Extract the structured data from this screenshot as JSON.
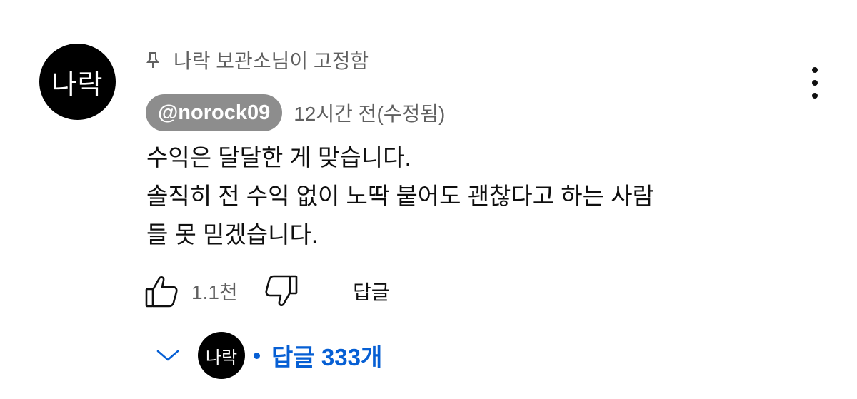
{
  "comment": {
    "avatar_text": "나락",
    "pinned_label": "나락 보관소님이 고정함",
    "author": "@norock09",
    "timestamp": "12시간 전(수정됨)",
    "text_lines": [
      "수익은 달달한 게 맞습니다.",
      "솔직히 전 수익 없이 노딱 붙어도 괜찮다고 하는 사람",
      "들 못 믿겠습니다."
    ],
    "like_count": "1.1천",
    "reply_label": "답글",
    "replies": {
      "avatar_text": "나락",
      "label": "답글 333개"
    }
  },
  "icons": {
    "pin": "pin-icon",
    "like": "thumb-up-icon",
    "dislike": "thumb-down-icon",
    "more": "more-vert-icon",
    "expand": "chevron-down-icon"
  },
  "colors": {
    "link_blue": "#065fd4",
    "secondary_text": "#606060",
    "author_chip_bg": "#8d8d8d",
    "primary_text": "#0f0f0f"
  }
}
